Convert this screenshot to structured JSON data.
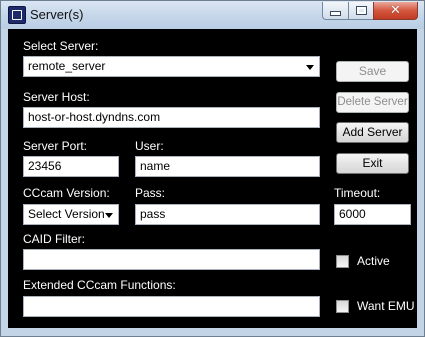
{
  "window": {
    "title": "Server(s)"
  },
  "labels": {
    "select_server": "Select Server:",
    "server_host": "Server Host:",
    "server_port": "Server Port:",
    "user": "User:",
    "cccam_version": "CCcam Version:",
    "pass": "Pass:",
    "timeout": "Timeout:",
    "caid_filter": "CAID Filter:",
    "extended": "Extended CCcam Functions:"
  },
  "fields": {
    "server_select": "remote_server",
    "server_host": "host-or-host.dyndns.com",
    "server_port": "23456",
    "user": "name",
    "cccam_version": "Select Version",
    "pass": "pass",
    "timeout": "6000",
    "caid_filter": "",
    "extended": ""
  },
  "buttons": {
    "save": "Save",
    "delete": "Delete Server",
    "add": "Add Server",
    "exit": "Exit"
  },
  "checkboxes": {
    "active": {
      "label": "Active",
      "checked": false
    },
    "want_emu": {
      "label": "Want EMU",
      "checked": false
    }
  }
}
